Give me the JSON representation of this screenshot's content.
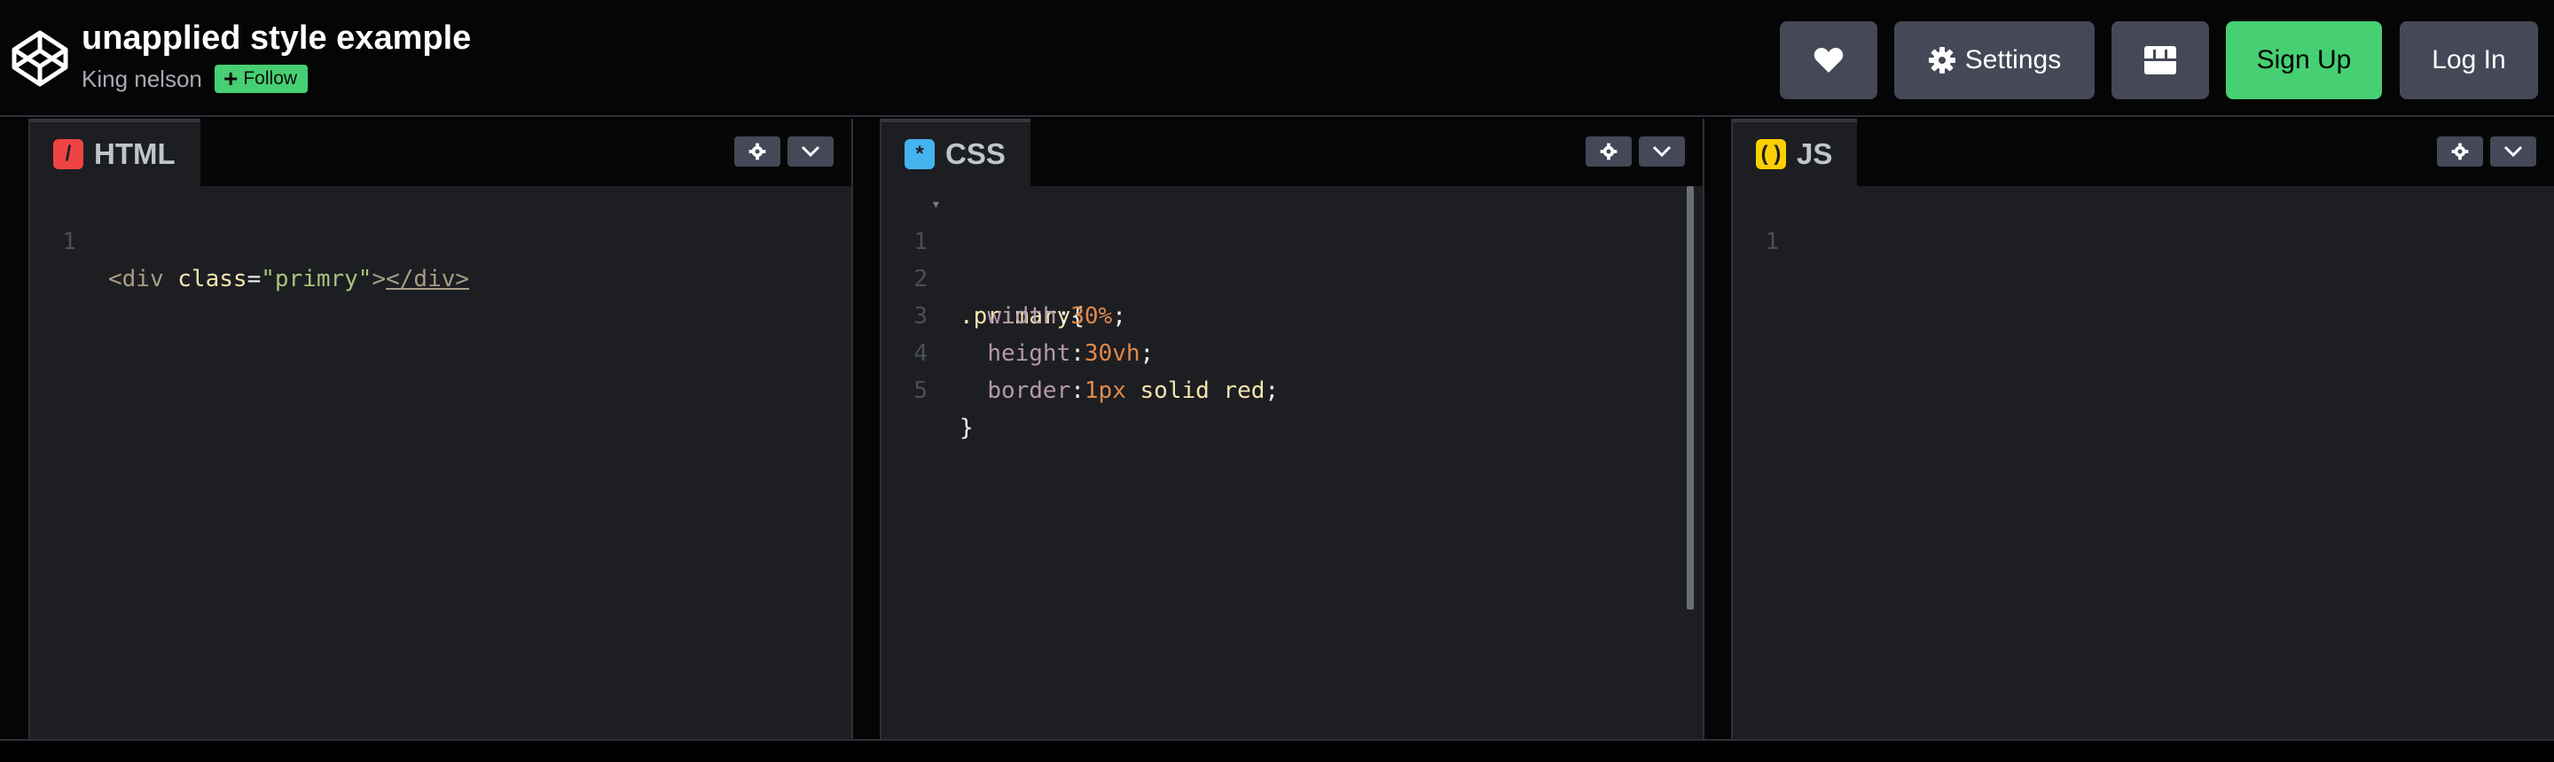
{
  "header": {
    "title": "unapplied style example",
    "author": "King nelson",
    "follow_label": "Follow",
    "buttons": {
      "settings_label": "Settings",
      "signup_label": "Sign Up",
      "login_label": "Log In"
    },
    "icons": [
      "codepen-logo-icon",
      "heart-icon",
      "gear-icon",
      "layout-grid-icon"
    ]
  },
  "panels": {
    "html": {
      "tab_label": "HTML",
      "icon": "html-slash-icon",
      "icon_color": "#ef4444"
    },
    "css": {
      "tab_label": "CSS",
      "icon": "css-asterisk-icon",
      "icon_color": "#44b4ef"
    },
    "js": {
      "tab_label": "JS",
      "icon": "js-braces-icon",
      "icon_color": "#fcd000"
    }
  },
  "code": {
    "html_lines": [
      {
        "n": "1",
        "parts": [
          "<div ",
          "class",
          "=",
          "\"primry\"",
          ">",
          "</div>"
        ]
      }
    ],
    "css_lines": [
      {
        "n": "1",
        "sel": ".primary",
        "open": "{"
      },
      {
        "n": "2",
        "prop": "width",
        "num": "30%",
        "rest": ";"
      },
      {
        "n": "3",
        "prop": "height",
        "num": "30vh",
        "rest": ";"
      },
      {
        "n": "4",
        "prop": "border",
        "num": "1px",
        "val": " solid red",
        "rest": ";"
      },
      {
        "n": "5",
        "close": "}"
      }
    ],
    "js_lines": [
      {
        "n": "1"
      }
    ]
  },
  "colors": {
    "accent_green": "#47cf73",
    "button_gray": "#444857",
    "editor_bg": "#1d1e22"
  }
}
